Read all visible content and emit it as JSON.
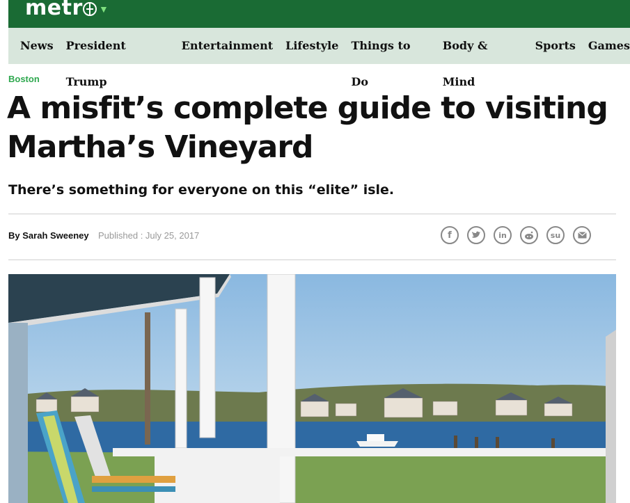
{
  "brand": {
    "logo_text": "metr",
    "logo_icon": "globe-icon"
  },
  "nav": {
    "items": [
      {
        "label": "News"
      },
      {
        "label": "President Trump"
      },
      {
        "label": "Entertainment"
      },
      {
        "label": "Lifestyle"
      },
      {
        "label": "Things to Do"
      },
      {
        "label": "Body & Mind"
      },
      {
        "label": "Sports"
      },
      {
        "label": "Games"
      }
    ]
  },
  "article": {
    "kicker": "Boston",
    "title": "A misfit’s complete guide to visiting Martha’s Vineyard",
    "subtitle": "There’s something for everyone on this “elite” isle.",
    "byline_prefix": "By",
    "author": "Sarah Sweeney",
    "published": "Published : July 25, 2017"
  },
  "share": {
    "icons": [
      "facebook-icon",
      "twitter-icon",
      "linkedin-icon",
      "reddit-icon",
      "stumbleupon-icon",
      "email-icon"
    ]
  },
  "colors": {
    "brand_green": "#1a6b34",
    "nav_bg": "#d8e6dc",
    "kicker_green": "#2fa84f"
  }
}
